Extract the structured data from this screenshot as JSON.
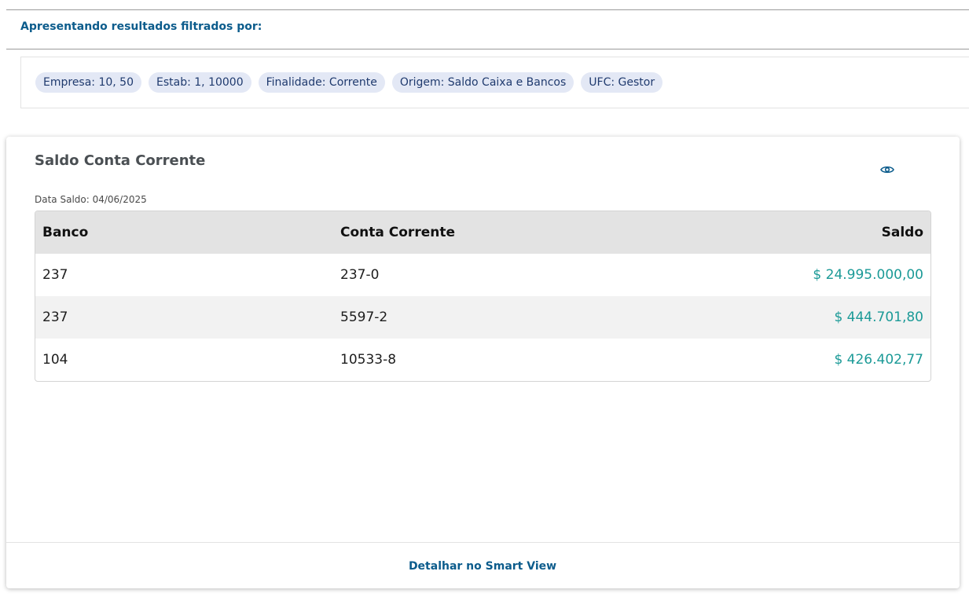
{
  "filters": {
    "title": "Apresentando resultados filtrados por:",
    "chips": [
      "Empresa: 10, 50",
      "Estab: 1, 10000",
      "Finalidade: Corrente",
      "Origem: Saldo Caixa e Bancos",
      "UFC: Gestor"
    ]
  },
  "card": {
    "title": "Saldo Conta Corrente",
    "view_icon": "eye-icon",
    "date_label": "Data Saldo: 04/06/2025",
    "table": {
      "headers": [
        "Banco",
        "Conta Corrente",
        "Saldo"
      ],
      "rows": [
        [
          "237",
          "237-0",
          "$ 24.995.000,00"
        ],
        [
          "237",
          "5597-2",
          "$ 444.701,80"
        ],
        [
          "104",
          "10533-8",
          "$ 426.402,77"
        ]
      ]
    },
    "footer_link": "Detalhar no Smart View"
  },
  "colors": {
    "accent": "#0c5c8c",
    "money": "#1b9a97",
    "chip_bg": "#e3e8f5",
    "chip_text": "#1f3a6e"
  }
}
